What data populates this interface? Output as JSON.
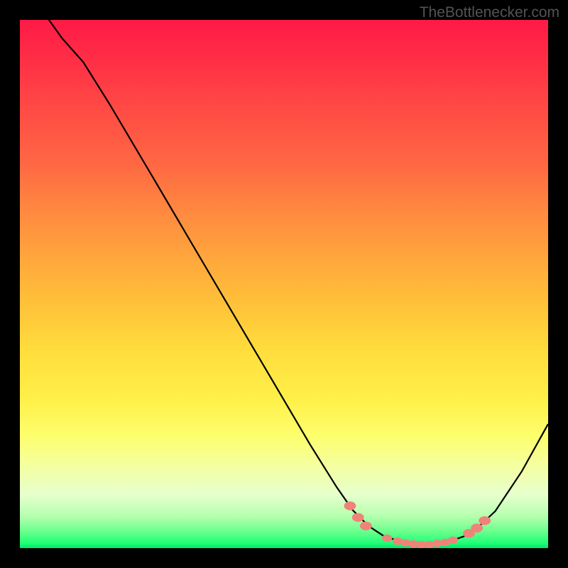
{
  "watermark": "TheBottlenecker.com",
  "chart_data": {
    "type": "line",
    "title": "",
    "xlabel": "",
    "ylabel": "",
    "xlim": [
      0,
      100
    ],
    "ylim": [
      0,
      100
    ],
    "series": [
      {
        "name": "curve",
        "points": [
          {
            "x": 5.5,
            "y": 100
          },
          {
            "x": 8,
            "y": 96.5
          },
          {
            "x": 12,
            "y": 92
          },
          {
            "x": 17,
            "y": 84
          },
          {
            "x": 25,
            "y": 70.5
          },
          {
            "x": 35,
            "y": 53.5
          },
          {
            "x": 45,
            "y": 36.5
          },
          {
            "x": 55,
            "y": 19.5
          },
          {
            "x": 60,
            "y": 11.5
          },
          {
            "x": 63,
            "y": 7.2
          },
          {
            "x": 66,
            "y": 4.2
          },
          {
            "x": 69,
            "y": 2.2
          },
          {
            "x": 73,
            "y": 1.0
          },
          {
            "x": 77,
            "y": 0.7
          },
          {
            "x": 81,
            "y": 1.2
          },
          {
            "x": 84,
            "y": 2.2
          },
          {
            "x": 87,
            "y": 4.2
          },
          {
            "x": 90,
            "y": 7.0
          },
          {
            "x": 95,
            "y": 14.5
          },
          {
            "x": 100,
            "y": 23.5
          }
        ]
      }
    ],
    "markers": [
      {
        "x": 62.5,
        "y": 8.0,
        "r": 1.2
      },
      {
        "x": 64.0,
        "y": 5.8,
        "r": 1.2
      },
      {
        "x": 65.5,
        "y": 4.2,
        "r": 1.2
      },
      {
        "x": 69.5,
        "y": 1.9,
        "r": 1.0
      },
      {
        "x": 71.5,
        "y": 1.3,
        "r": 1.0
      },
      {
        "x": 73.0,
        "y": 1.0,
        "r": 1.0
      },
      {
        "x": 74.5,
        "y": 0.8,
        "r": 1.0
      },
      {
        "x": 76.0,
        "y": 0.7,
        "r": 1.0
      },
      {
        "x": 77.5,
        "y": 0.7,
        "r": 1.0
      },
      {
        "x": 79.0,
        "y": 0.9,
        "r": 1.0
      },
      {
        "x": 80.5,
        "y": 1.1,
        "r": 1.0
      },
      {
        "x": 82.0,
        "y": 1.5,
        "r": 1.0
      },
      {
        "x": 85.0,
        "y": 2.8,
        "r": 1.2
      },
      {
        "x": 86.5,
        "y": 3.8,
        "r": 1.2
      },
      {
        "x": 88.0,
        "y": 5.2,
        "r": 1.2
      }
    ],
    "marker_color": "#f08379",
    "curve_color": "#000000"
  }
}
